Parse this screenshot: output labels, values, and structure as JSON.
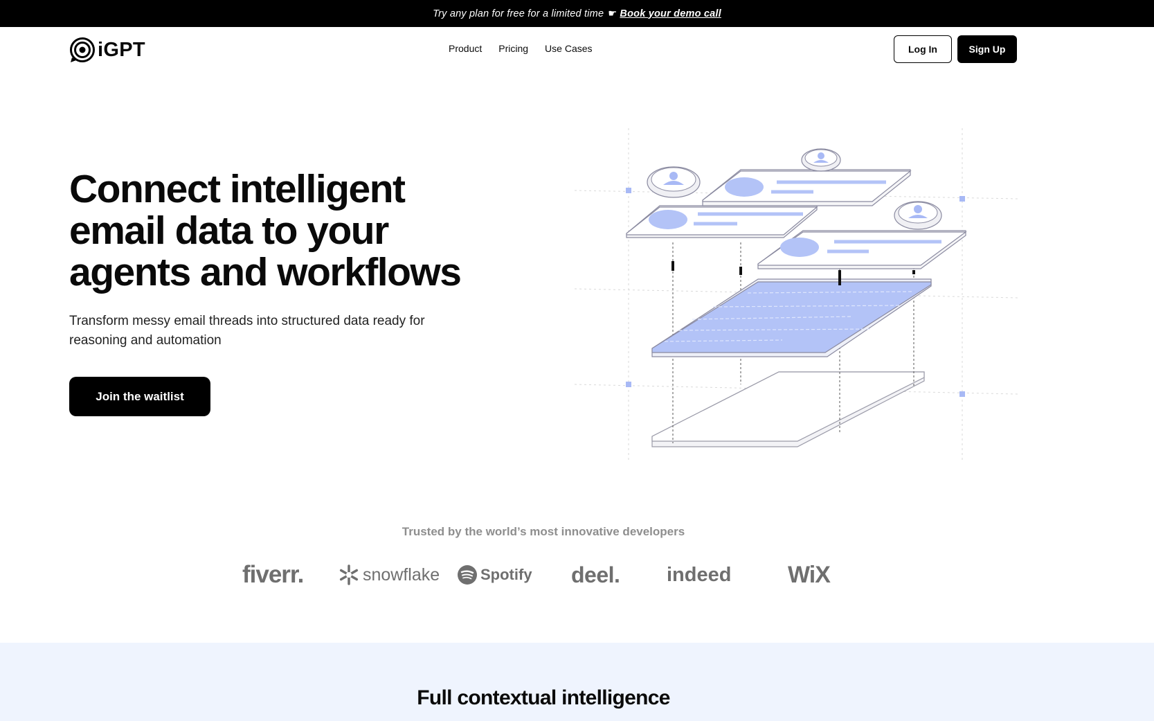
{
  "promo": {
    "text": "Try any plan for free for a limited time",
    "pointer_icon": "pointing-hand-icon",
    "link_label": "Book your demo call"
  },
  "nav": {
    "logo_text": "iGPT",
    "links": [
      "Product",
      "Pricing",
      "Use Cases"
    ],
    "login_label": "Log In",
    "signup_label": "Sign Up"
  },
  "hero": {
    "title_line1": "Connect intelligent",
    "title_line2": "email data to your",
    "title_line3": "agents and workflows",
    "subtitle": "Transform messy email threads into structured data ready for reasoning and automation",
    "cta_label": "Join the waitlist"
  },
  "trusted": {
    "label": "Trusted by the world’s most innovative developers",
    "brands": [
      "fiverr.",
      "snowflake",
      "Spotify",
      "deel.",
      "indeed",
      "WiX"
    ]
  },
  "features": {
    "title": "Full contextual intelligence"
  },
  "colors": {
    "accent": "#b3c3f7",
    "accent_dark": "#8fa5f0",
    "section_bg": "#eff4fe",
    "muted_text": "#8e8e8e"
  }
}
